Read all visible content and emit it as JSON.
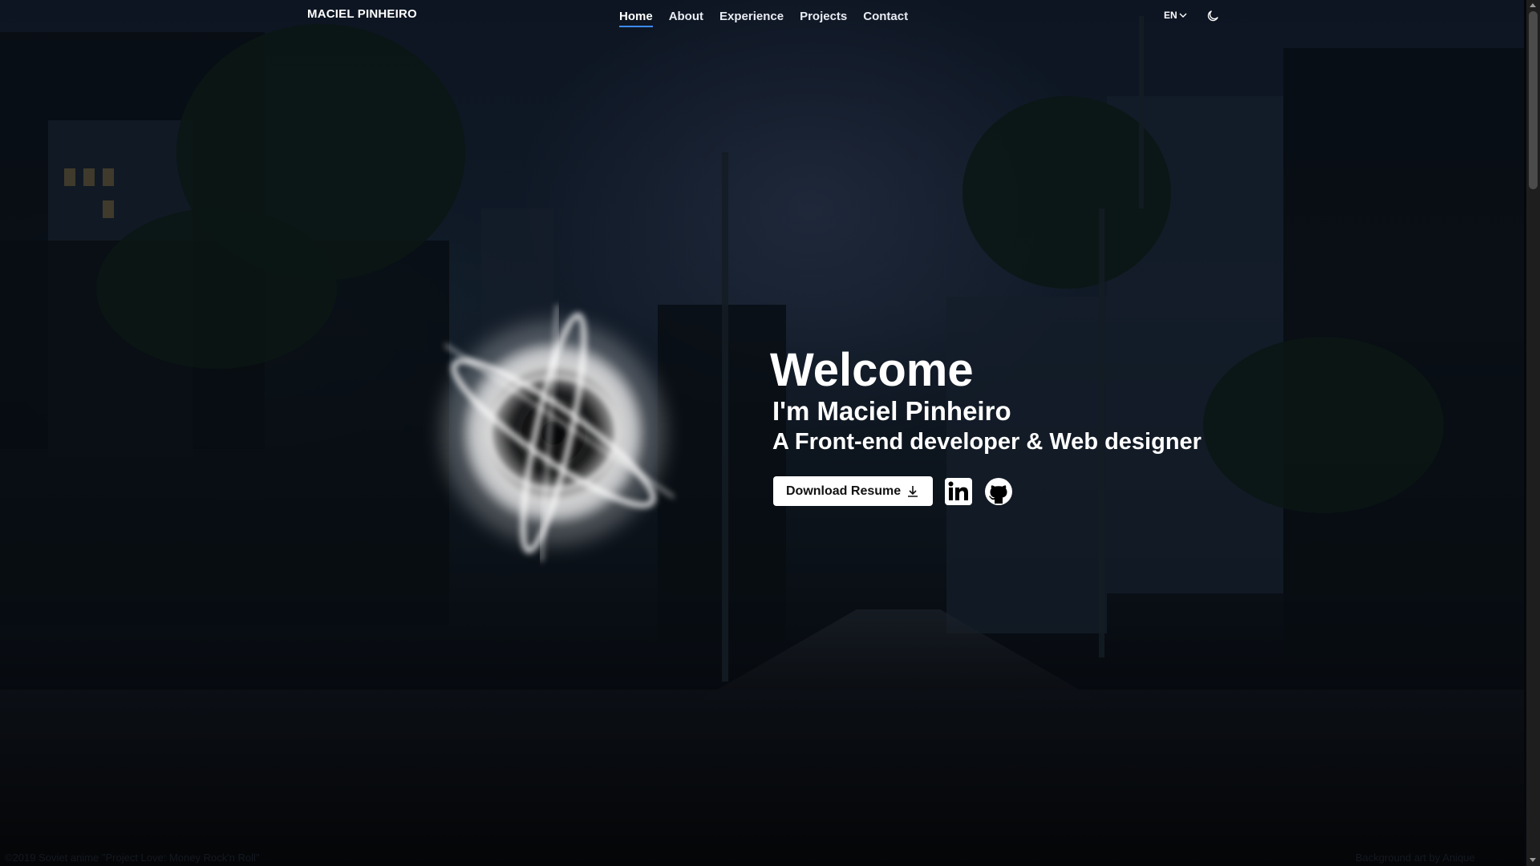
{
  "brand": "MACIEL PINHEIRO",
  "nav": {
    "items": [
      {
        "label": "Home",
        "active": true
      },
      {
        "label": "About",
        "active": false
      },
      {
        "label": "Experience",
        "active": false
      },
      {
        "label": "Projects",
        "active": false
      },
      {
        "label": "Contact",
        "active": false
      }
    ],
    "language": "EN",
    "theme_icon": "moon-icon"
  },
  "hero": {
    "title": "Welcome",
    "subtitle": "I'm Maciel Pinheiro",
    "role": "A Front-end developer & Web designer",
    "resume_button": "Download Resume",
    "social": [
      "linkedin-icon",
      "github-icon"
    ]
  },
  "footer": {
    "left": "©2019 Soviet anime \"Project Love: Money Rock'n Roll\"",
    "right": "Background art by Anique"
  },
  "colors": {
    "accent": "#3d8bff",
    "background": "#05070c",
    "button_bg": "#ffffff"
  }
}
